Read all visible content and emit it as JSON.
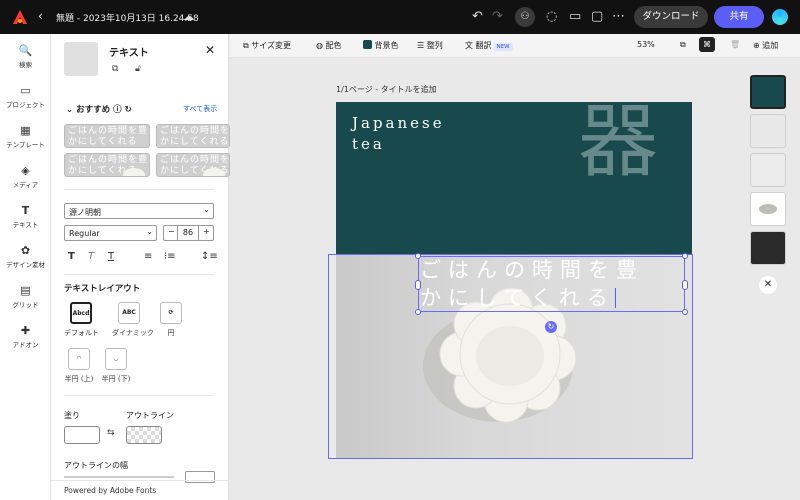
{
  "topbar": {
    "title": "無題 - 2023年10月13日 16.24.58",
    "download": "ダウンロード",
    "share": "共有"
  },
  "rail": [
    {
      "icon": "🔍",
      "label": "検索"
    },
    {
      "icon": "▭",
      "label": "プロジェクト"
    },
    {
      "icon": "▦",
      "label": "テンプレート"
    },
    {
      "icon": "◈",
      "label": "メディア"
    },
    {
      "icon": "T",
      "label": "テキスト"
    },
    {
      "icon": "✿",
      "label": "デザイン素材"
    },
    {
      "icon": "▤",
      "label": "グリッド"
    },
    {
      "icon": "✚",
      "label": "アドオン"
    }
  ],
  "panel": {
    "title": "テキスト",
    "recommend": "おすすめ",
    "see_all": "すべて表示",
    "tile_text": "ごはんの時間を豊",
    "tile_text2": "かにしてくれる",
    "font": "源ノ明朝",
    "weight": "Regular",
    "size": "86",
    "layout_title": "テキストレイアウト",
    "layouts": [
      {
        "icon": "Abcd",
        "label": "デフォルト"
      },
      {
        "icon": "ABC",
        "label": "ダイナミック"
      },
      {
        "icon": "⟳",
        "label": "円"
      },
      {
        "icon": "◠",
        "label": "半円 (上)"
      },
      {
        "icon": "◡",
        "label": "半円 (下)"
      }
    ],
    "fill": "塗り",
    "outline": "アウトライン",
    "outline_width": "アウトラインの幅",
    "footer": "Powered by Adobe Fonts"
  },
  "toolbar": {
    "resize": "サイズ変更",
    "palette": "配色",
    "bg": "背景色",
    "arrange": "整列",
    "translate": "翻訳",
    "new": "NEW",
    "zoom": "53%",
    "add": "追加"
  },
  "canvas": {
    "breadcrumb": "1/1ページ - タイトルを追加",
    "line1": "Japanese",
    "line2": "tea",
    "kanji": "器",
    "body1": "ごはんの時間を豊",
    "body2": "かにしてくれる"
  }
}
